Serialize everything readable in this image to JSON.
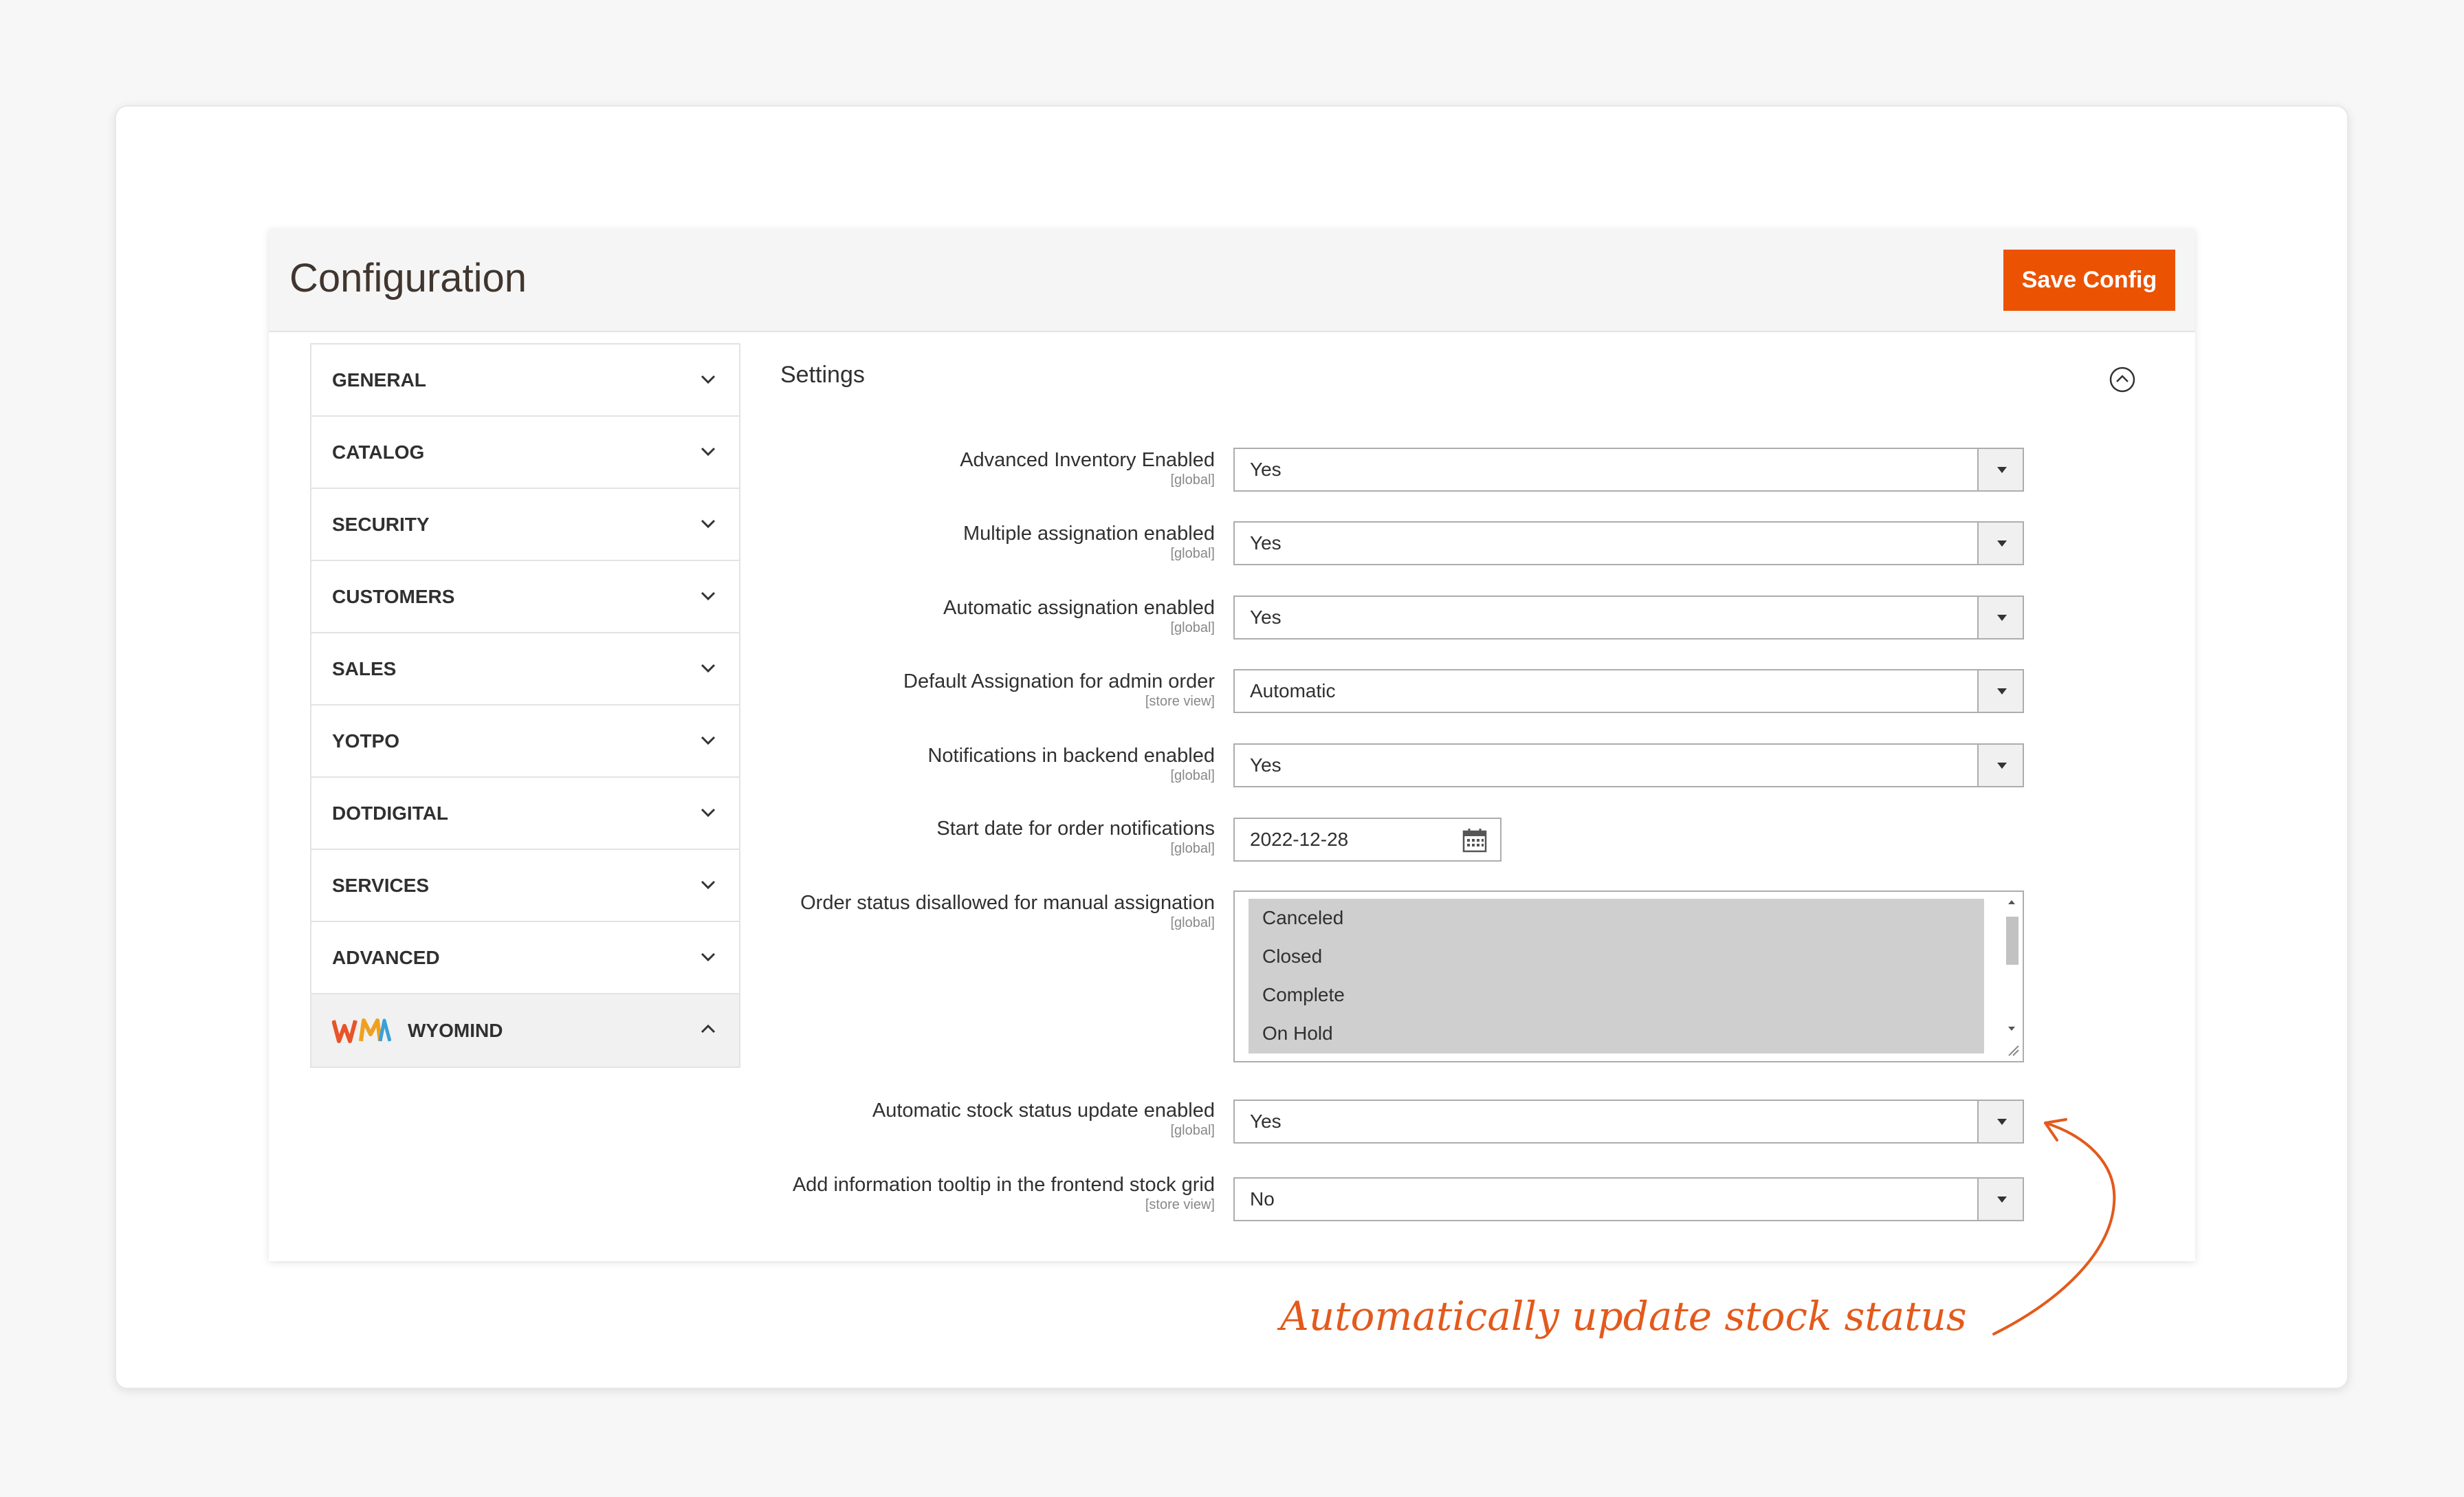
{
  "header": {
    "title": "Configuration",
    "save_label": "Save Config"
  },
  "sidebar": {
    "items": [
      {
        "label": "GENERAL",
        "expanded": false
      },
      {
        "label": "CATALOG",
        "expanded": false
      },
      {
        "label": "SECURITY",
        "expanded": false
      },
      {
        "label": "CUSTOMERS",
        "expanded": false
      },
      {
        "label": "SALES",
        "expanded": false
      },
      {
        "label": "YOTPO",
        "expanded": false
      },
      {
        "label": "DOTDIGITAL",
        "expanded": false
      },
      {
        "label": "SERVICES",
        "expanded": false
      },
      {
        "label": "ADVANCED",
        "expanded": false
      },
      {
        "label": "WYOMIND",
        "expanded": true,
        "icon": "wyomind-logo"
      }
    ]
  },
  "settings": {
    "title": "Settings",
    "fields": [
      {
        "label": "Advanced Inventory Enabled",
        "scope": "[global]",
        "value": "Yes"
      },
      {
        "label": "Multiple assignation enabled",
        "scope": "[global]",
        "value": "Yes"
      },
      {
        "label": "Automatic assignation enabled",
        "scope": "[global]",
        "value": "Yes"
      },
      {
        "label": "Default Assignation for admin order",
        "scope": "[store view]",
        "value": "Automatic"
      },
      {
        "label": "Notifications in backend enabled",
        "scope": "[global]",
        "value": "Yes"
      },
      {
        "label": "Start date for order notifications",
        "scope": "[global]",
        "value": "2022-12-28"
      },
      {
        "label": "Order status disallowed for manual assignation",
        "scope": "[global]",
        "options": [
          "Canceled",
          "Closed",
          "Complete",
          "On Hold"
        ]
      },
      {
        "label": "Automatic stock status update enabled",
        "scope": "[global]",
        "value": "Yes"
      },
      {
        "label": "Add information tooltip in the frontend stock grid",
        "scope": "[store view]",
        "value": "No"
      }
    ]
  },
  "annotation": "Automatically update stock status",
  "colors": {
    "accent": "#eb5202",
    "annotation": "#e35a1c"
  }
}
